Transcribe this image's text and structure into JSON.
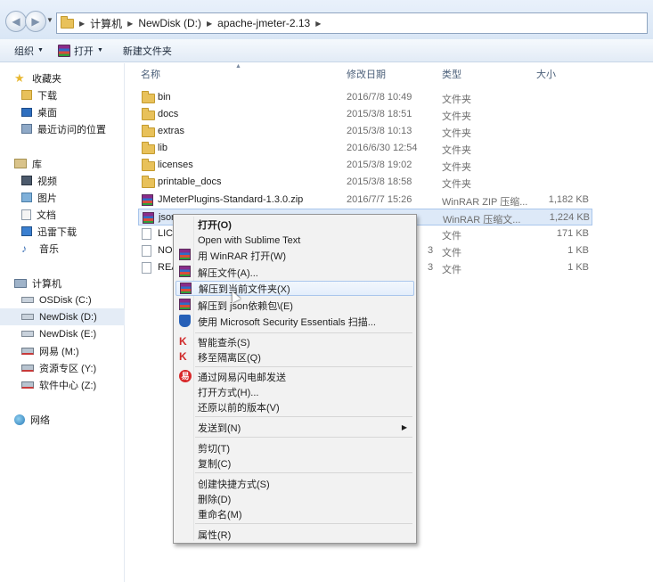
{
  "address": {
    "crumbs": [
      "计算机",
      "NewDisk (D:)",
      "apache-jmeter-2.13"
    ]
  },
  "toolbar": {
    "organize": "组织",
    "open": "打开",
    "new_folder": "新建文件夹"
  },
  "nav": {
    "favorites": "收藏夹",
    "downloads": "下载",
    "desktop": "桌面",
    "recent": "最近访问的位置",
    "library": "库",
    "videos": "视频",
    "pictures": "图片",
    "documents": "文档",
    "xunlei": "迅雷下载",
    "music": "音乐",
    "computer": "计算机",
    "osdisk": "OSDisk (C:)",
    "newdisk_d": "NewDisk (D:)",
    "newdisk_e": "NewDisk (E:)",
    "netease": "网易 (M:)",
    "resource": "资源专区 (Y:)",
    "software": "软件中心 (Z:)",
    "network": "网络"
  },
  "columns": {
    "name": "名称",
    "date": "修改日期",
    "type": "类型",
    "size": "大小"
  },
  "files": [
    {
      "name": "bin",
      "date": "2016/7/8 10:49",
      "type": "文件夹",
      "size": ""
    },
    {
      "name": "docs",
      "date": "2015/3/8 18:51",
      "type": "文件夹",
      "size": ""
    },
    {
      "name": "extras",
      "date": "2015/3/8 10:13",
      "type": "文件夹",
      "size": ""
    },
    {
      "name": "lib",
      "date": "2016/6/30 12:54",
      "type": "文件夹",
      "size": ""
    },
    {
      "name": "licenses",
      "date": "2015/3/8 19:02",
      "type": "文件夹",
      "size": ""
    },
    {
      "name": "printable_docs",
      "date": "2015/3/8 18:58",
      "type": "文件夹",
      "size": ""
    },
    {
      "name": "JMeterPlugins-Standard-1.3.0.zip",
      "date": "2016/7/7 15:26",
      "type": "WinRAR ZIP 压缩...",
      "size": "1,182 KB"
    },
    {
      "name": "json",
      "date": "",
      "type": "WinRAR 压缩文...",
      "size": "1,224 KB"
    },
    {
      "name": "LIC",
      "date": "",
      "type": "文件",
      "size": "171 KB"
    },
    {
      "name": "NO",
      "date": "3",
      "type": "文件",
      "size": "1 KB"
    },
    {
      "name": "REA",
      "date": "3",
      "type": "文件",
      "size": "1 KB"
    }
  ],
  "menu": {
    "open": "打开(O)",
    "sublime": "Open with Sublime Text",
    "winrar_open": "用 WinRAR 打开(W)",
    "extract_files": "解压文件(A)...",
    "extract_here": "解压到当前文件夹(X)",
    "extract_to": "解压到 json依赖包\\(E)",
    "mse_scan": "使用 Microsoft Security Essentials 扫描...",
    "smart_scan": "智能查杀(S)",
    "quarantine": "移至隔离区(Q)",
    "netease_send": "通过网易闪电邮发送",
    "open_with": "打开方式(H)...",
    "restore": "还原以前的版本(V)",
    "send_to": "发送到(N)",
    "cut": "剪切(T)",
    "copy": "复制(C)",
    "shortcut": "创建快捷方式(S)",
    "delete": "删除(D)",
    "rename": "重命名(M)",
    "properties": "属性(R)"
  },
  "icons": {
    "back": "back-arrow-icon",
    "forward": "forward-arrow-icon",
    "folder": "folder-icon",
    "winrar": "winrar-icon",
    "shield": "security-shield-icon",
    "netease": "netease-icon",
    "kaspersky": "kaspersky-icon"
  },
  "colors": {
    "selection": "#dde9f8",
    "menu_bg": "#f2f2f2",
    "accent": "#2660b8"
  }
}
